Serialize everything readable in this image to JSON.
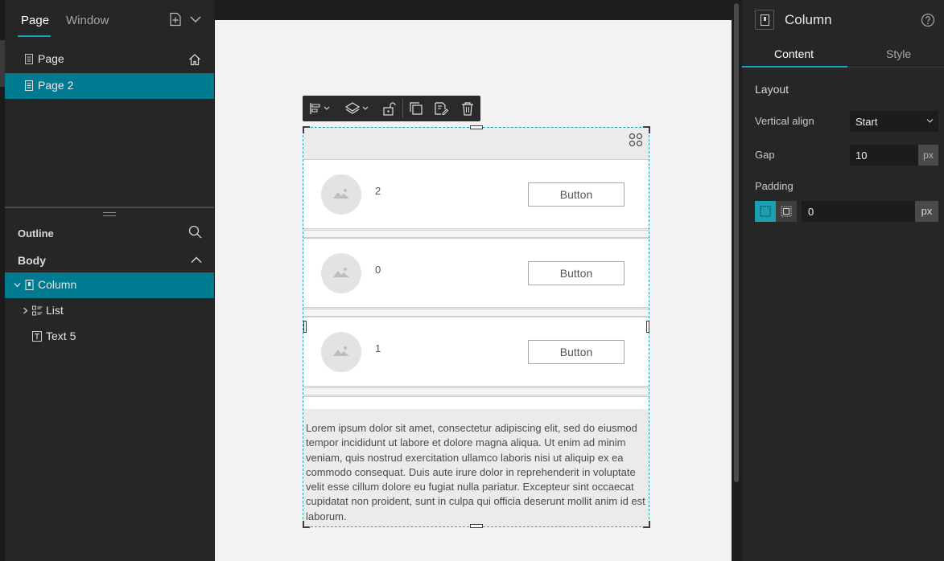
{
  "left_panel": {
    "tabs": [
      {
        "label": "Page",
        "active": true
      },
      {
        "label": "Window",
        "active": false
      }
    ],
    "pages": [
      {
        "label": "Page",
        "home": true
      },
      {
        "label": "Page 2",
        "selected": true
      }
    ],
    "outline": {
      "title": "Outline",
      "section": "Body",
      "tree": [
        {
          "label": "Column",
          "selected": true,
          "expanded": true,
          "icon": "column-icon"
        },
        {
          "label": "List",
          "expanded": false,
          "icon": "list-icon"
        },
        {
          "label": "Text 5",
          "icon": "text-icon"
        }
      ]
    }
  },
  "canvas": {
    "toolbar_icons": [
      "align-icon",
      "layers-icon",
      "unlock-icon",
      "duplicate-icon",
      "save-template-icon",
      "delete-icon"
    ],
    "list_items": [
      {
        "number": "2",
        "button": "Button"
      },
      {
        "number": "0",
        "button": "Button"
      },
      {
        "number": "1",
        "button": "Button"
      }
    ],
    "text": "Lorem ipsum dolor sit amet, consectetur adipiscing elit, sed do eiusmod tempor incididunt ut labore et dolore magna aliqua. Ut enim ad minim veniam, quis nostrud exercitation ullamco laboris nisi ut aliquip ex ea commodo consequat. Duis aute irure dolor in reprehenderit in voluptate velit esse cillum dolore eu fugiat nulla pariatur. Excepteur sint occaecat cupidatat non proident, sunt in culpa qui officia deserunt mollit anim id est laborum."
  },
  "right_panel": {
    "title": "Column",
    "tabs": [
      {
        "label": "Content",
        "active": true
      },
      {
        "label": "Style",
        "active": false
      }
    ],
    "layout": {
      "heading": "Layout",
      "vertical_align_label": "Vertical align",
      "vertical_align_value": "Start",
      "gap_label": "Gap",
      "gap_value": "10",
      "gap_unit": "px",
      "padding_label": "Padding",
      "padding_value": "0",
      "padding_unit": "px"
    }
  },
  "colors": {
    "accent": "#1aa5bb",
    "selected_row": "#007a91",
    "panel_bg": "#262626"
  }
}
